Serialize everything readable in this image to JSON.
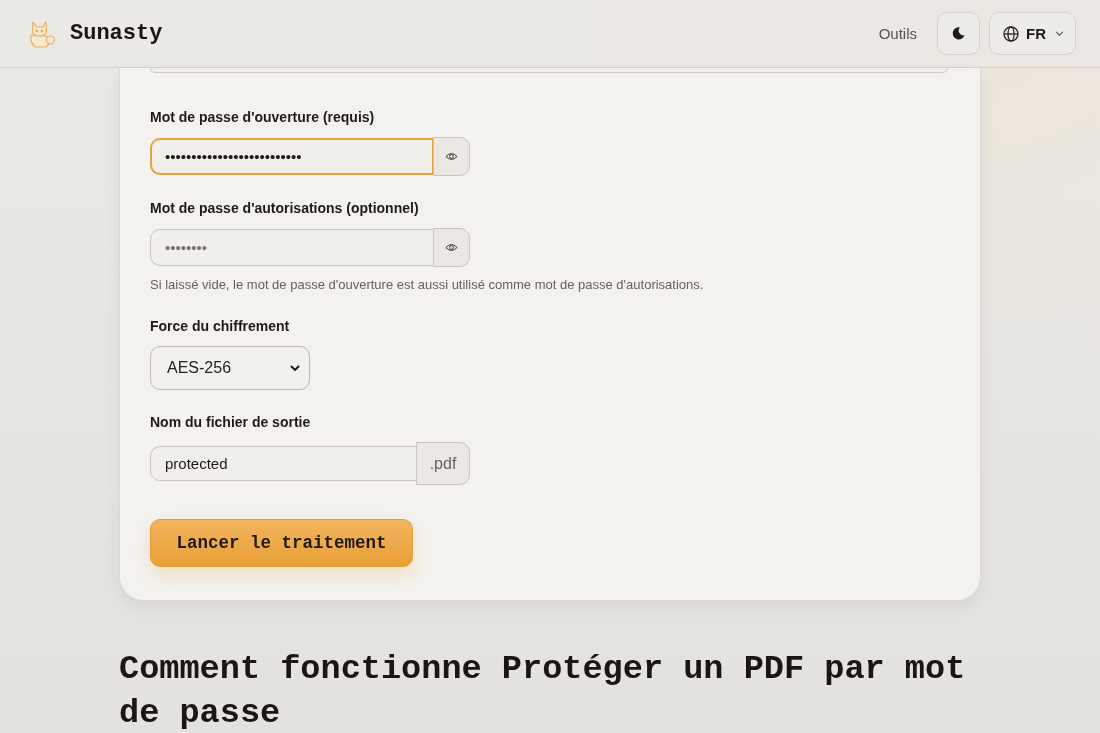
{
  "header": {
    "brand": "Sunasty",
    "nav_link": "Outils",
    "language": "FR"
  },
  "form": {
    "fields": [
      {
        "kind": "password",
        "label": "Mot de passe d'ouverture (requis)",
        "value": "••••••••••••••••••••••••••",
        "focused": true
      },
      {
        "kind": "password",
        "label": "Mot de passe d'autorisations (optionnel)",
        "placeholder": "••••••••",
        "focused": false,
        "hint": "Si laissé vide, le mot de passe d'ouverture est aussi utilisé comme mot de passe d'autorisations."
      },
      {
        "kind": "select",
        "label": "Force du chiffrement",
        "value": "AES-256",
        "focused": false
      },
      {
        "kind": "suffix",
        "label": "Nom du fichier de sortie",
        "value": "protected",
        "suffix": ".pdf",
        "focused": false
      }
    ],
    "submit": "Lancer le traitement"
  },
  "section_heading": "Comment fonctionne Protéger un PDF par mot de passe"
}
